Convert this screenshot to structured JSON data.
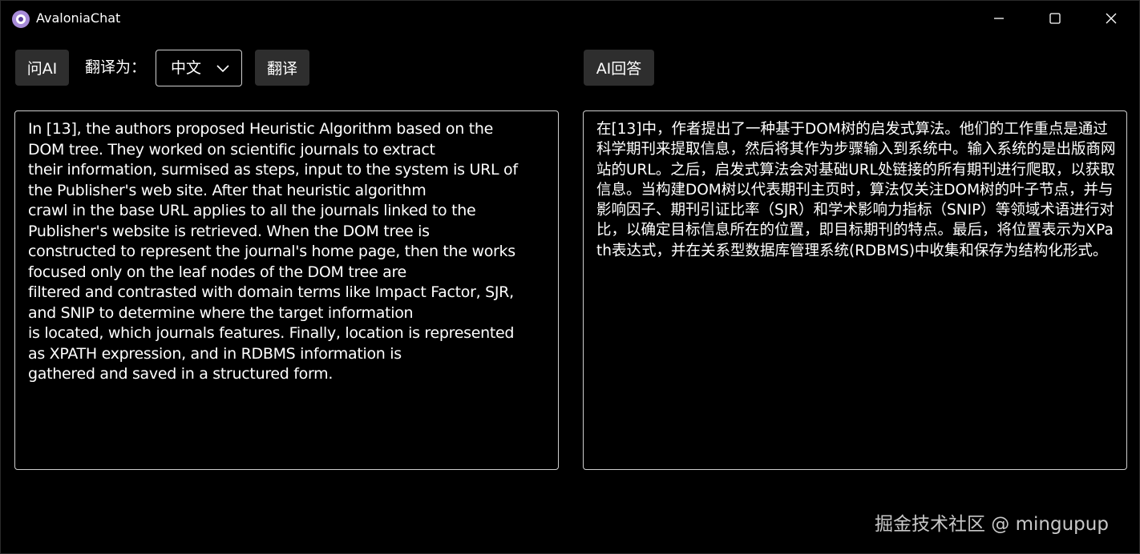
{
  "window": {
    "title": "AvaloniaChat",
    "minimize_icon": "minimize-icon",
    "maximize_icon": "maximize-icon",
    "close_icon": "close-icon"
  },
  "toolbar": {
    "ask_ai_label": "问AI",
    "translate_to_label": "翻译为：",
    "language_selected": "中文",
    "translate_label": "翻译",
    "ai_answer_label": "AI回答"
  },
  "source_text": "In [13], the authors proposed Heuristic Algorithm based on the\nDOM tree. They worked on scientific journals to extract\ntheir information, surmised as steps, input to the system is URL of\nthe Publisher's web site. After that heuristic algorithm\ncrawl in the base URL applies to all the journals linked to the\nPublisher's website is retrieved. When the DOM tree is\nconstructed to represent the journal's home page, then the works\nfocused only on the leaf nodes of the DOM tree are\nfiltered and contrasted with domain terms like Impact Factor, SJR,\nand SNIP to determine where the target information\nis located, which journals features. Finally, location is represented\nas XPATH expression, and in RDBMS information is\ngathered and saved in a structured form.",
  "result_text": "在[13]中，作者提出了一种基于DOM树的启发式算法。他们的工作重点是通过科学期刊来提取信息，然后将其作为步骤输入到系统中。输入系统的是出版商网站的URL。之后，启发式算法会对基础URL处链接的所有期刊进行爬取，以获取信息。当构建DOM树以代表期刊主页时，算法仅关注DOM树的叶子节点，并与影响因子、期刊引证比率（SJR）和学术影响力指标（SNIP）等领域术语进行对比，以确定目标信息所在的位置，即目标期刊的特点。最后，将位置表示为XPath表达式，并在关系型数据库管理系统(RDBMS)中收集和保存为结构化形式。",
  "watermark": "掘金技术社区 @ mingupup",
  "colors": {
    "background": "#000000",
    "button_bg": "#2e2e2e",
    "border": "#cfcfcf",
    "logo": "#a78bd8"
  }
}
